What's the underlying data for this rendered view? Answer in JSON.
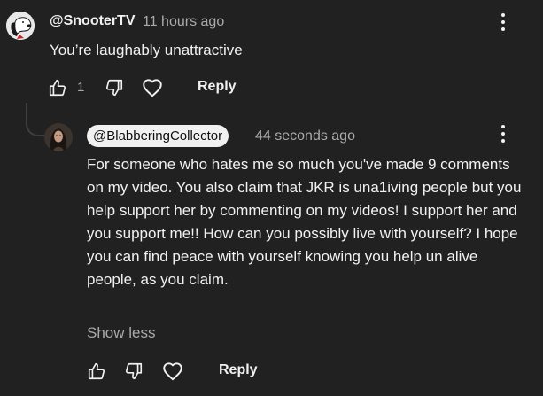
{
  "top_comment": {
    "author": "@SnooterTV",
    "time": "11 hours ago",
    "text": "You’re laughably unattractive",
    "like_count": "1",
    "reply_label": "Reply",
    "avatar_icon": "snoopy-cartoon-avatar"
  },
  "reply_comment": {
    "author": "@BlabberingCollector",
    "time": "44 seconds ago",
    "text": "For someone who hates me so much you've made 9 comments on my video. You also claim that JKR is una1iving people but you help support her by commenting on my videos! I support her and you support me!! How can you possibly live with yourself? I hope you can find peace with yourself knowing you help un alive people, as you claim.",
    "show_less_label": "Show less",
    "reply_label": "Reply",
    "avatar_icon": "profile-photo-avatar"
  },
  "colors": {
    "background": "#212121",
    "text": "#f1f1f1",
    "secondary_text": "#aaaaaa",
    "author_chip_bg": "#f1f1f1"
  }
}
